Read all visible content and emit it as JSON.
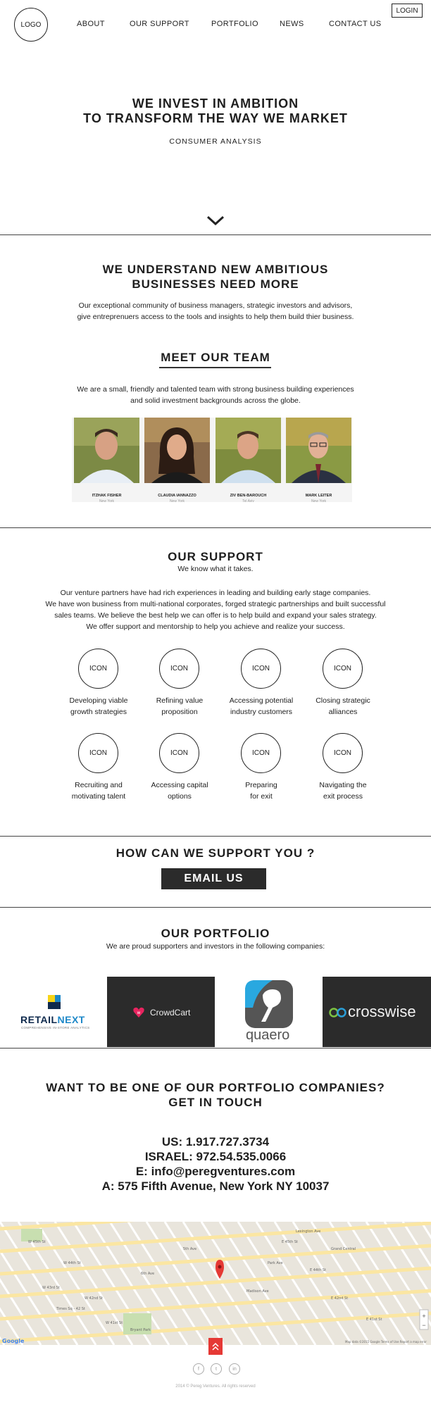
{
  "nav": {
    "logo": "LOGO",
    "items": [
      "ABOUT",
      "OUR SUPPORT",
      "PORTFOLIO",
      "NEWS",
      "CONTACT US"
    ],
    "login": "LOGIN"
  },
  "hero": {
    "line1": "WE INVEST IN AMBITION",
    "line2": "TO TRANSFORM THE WAY WE MARKET",
    "subtitle": "CONSUMER ANALYSIS"
  },
  "understand": {
    "line1": "WE UNDERSTAND NEW AMBITIOUS",
    "line2": "BUSINESSES NEED MORE",
    "p1": "Our exceptional community of business managers, strategic investors and advisors,",
    "p2": "give entreprenuers access to the tools and insights to help them build thier business."
  },
  "team": {
    "title": "MEET OUR TEAM",
    "p1": "We are a small, friendly and talented team with strong business building experiences",
    "p2": "and solid investment backgrounds across the globe.",
    "members": [
      {
        "name": "ITZHAK FISHER",
        "city": "New York"
      },
      {
        "name": "CLAUDIA IANNAZZO",
        "city": "New York"
      },
      {
        "name": "ZIV BEN-BAROUCH",
        "city": "Tel Aviv"
      },
      {
        "name": "MARK LEITER",
        "city": "New York"
      }
    ]
  },
  "support": {
    "title": "OUR SUPPORT",
    "tagline": "We know what it takes.",
    "p1": "Our venture partners have had rich experiences in leading and building early stage companies.",
    "p2": "We have won business from multi-national corporates, forged strategic partnerships and built successful",
    "p3": "sales teams. We believe the best help we can offer is to help build and expand your sales strategy.",
    "p4": "We offer support and mentorship to help you achieve and realize your success.",
    "icon_text": "ICON",
    "items": [
      {
        "l1": "Developing viable",
        "l2": "growth strategies"
      },
      {
        "l1": "Refining value",
        "l2": "proposition"
      },
      {
        "l1": "Accessing potential",
        "l2": "industry customers"
      },
      {
        "l1": "Closing strategic",
        "l2": "alliances"
      },
      {
        "l1": "Recruiting and",
        "l2": "motivating talent"
      },
      {
        "l1": "Accessing capital",
        "l2": "options"
      },
      {
        "l1": "Preparing",
        "l2": "for exit"
      },
      {
        "l1": "Navigating the",
        "l2": "exit process"
      }
    ]
  },
  "cta": {
    "title": "HOW CAN WE SUPPORT YOU ?",
    "button": "EMAIL US"
  },
  "portfolio": {
    "title": "OUR PORTFOLIO",
    "subtitle": "We are proud supporters and investors in the following companies:",
    "retailnext_a": "RETAIL",
    "retailnext_b": "NEXT",
    "retailnext_tag": "COMPREHENSIVE IN-STORE ANALYTICS",
    "crowdcart": "CrowdCart",
    "quaero": "quaero",
    "crosswise": "crosswise"
  },
  "getintouch": {
    "line1": "WANT TO BE ONE OF OUR PORTFOLIO COMPANIES?",
    "line2": "GET IN TOUCH",
    "us": "US: 1.917.727.3734",
    "israel": "ISRAEL: 972.54.535.0066",
    "email": "E: info@peregventures.com",
    "address": "A: 575 Fifth Avenue, New York NY 10037"
  },
  "map": {
    "labels": [
      "W 45th St",
      "W 44th St",
      "W 43rd St",
      "W 42nd St",
      "W 41st St",
      "E 45th St",
      "E 44th St",
      "E 42nd St",
      "E 41st St",
      "Times Sq - 42 St",
      "Grand Central",
      "Bryant Park",
      "Madison Ave",
      "Park Ave",
      "Lexington Ave",
      "5th Ave",
      "6th Ave"
    ],
    "google": "Google",
    "attribution": "Map data ©2015 Google   Terms of Use   Report a map error"
  },
  "footer": {
    "social": [
      "f",
      "t",
      "in"
    ],
    "copyright": "2014 © Pereg Ventures. All rights reserved"
  },
  "colors": {
    "text": "#1e1e1e",
    "dark_tile": "#2b2b2b",
    "crowdcart_pink": "#e8245f",
    "crosswise_green": "#7dc242",
    "map_pin": "#e53935",
    "retailnext_blue": "#1e3a8a"
  }
}
